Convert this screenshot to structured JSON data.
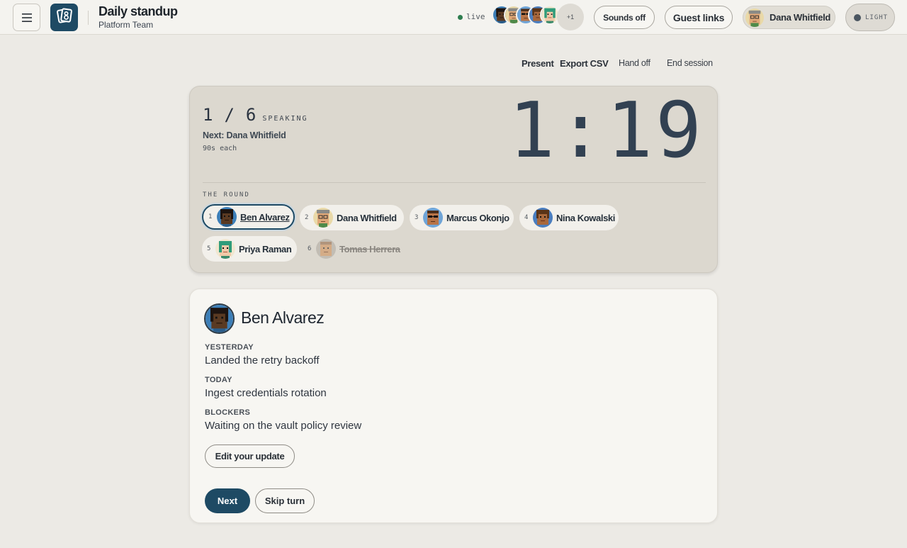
{
  "header": {
    "menu_icon": "hamburger-icon",
    "logo_icon": "standup-logo",
    "title": "Daily standup",
    "subtitle": "Platform Team",
    "live_label": "live",
    "presence_more": "+1",
    "sounds_label": "Sounds off",
    "guest_links_label": "Guest links",
    "user_name": "Dana Whitfield",
    "theme_label": "LIGHT"
  },
  "actions": {
    "present": "Present",
    "export_csv": "Export CSV",
    "hand_off": "Hand off",
    "end_session": "End session"
  },
  "timer": {
    "current": "1",
    "total": "6",
    "speaking_label": "SPEAKING",
    "next_label": "Next: Dana Whitfield",
    "per_person": "90s each",
    "clock": "1:19",
    "round_label": "THE ROUND"
  },
  "round": [
    {
      "num": "1",
      "name": "Ben Alvarez",
      "state": "active"
    },
    {
      "num": "2",
      "name": "Dana Whitfield",
      "state": "pending"
    },
    {
      "num": "3",
      "name": "Marcus Okonjo",
      "state": "pending"
    },
    {
      "num": "4",
      "name": "Nina Kowalski",
      "state": "pending"
    },
    {
      "num": "5",
      "name": "Priya Raman",
      "state": "pending"
    },
    {
      "num": "6",
      "name": "Tomas Herrera",
      "state": "skipped"
    }
  ],
  "speaker": {
    "name": "Ben Alvarez",
    "yesterday_label": "YESTERDAY",
    "yesterday": "Landed the retry backoff",
    "today_label": "TODAY",
    "today": "Ingest credentials rotation",
    "blockers_label": "BLOCKERS",
    "blockers": "Waiting on the vault policy review",
    "edit_label": "Edit your update",
    "next_label": "Next",
    "skip_label": "Skip turn"
  },
  "colors": {
    "accent": "#1e4a64",
    "live": "#2e7d4f",
    "background": "#eceae5",
    "timer_card": "#dcd8cf"
  }
}
